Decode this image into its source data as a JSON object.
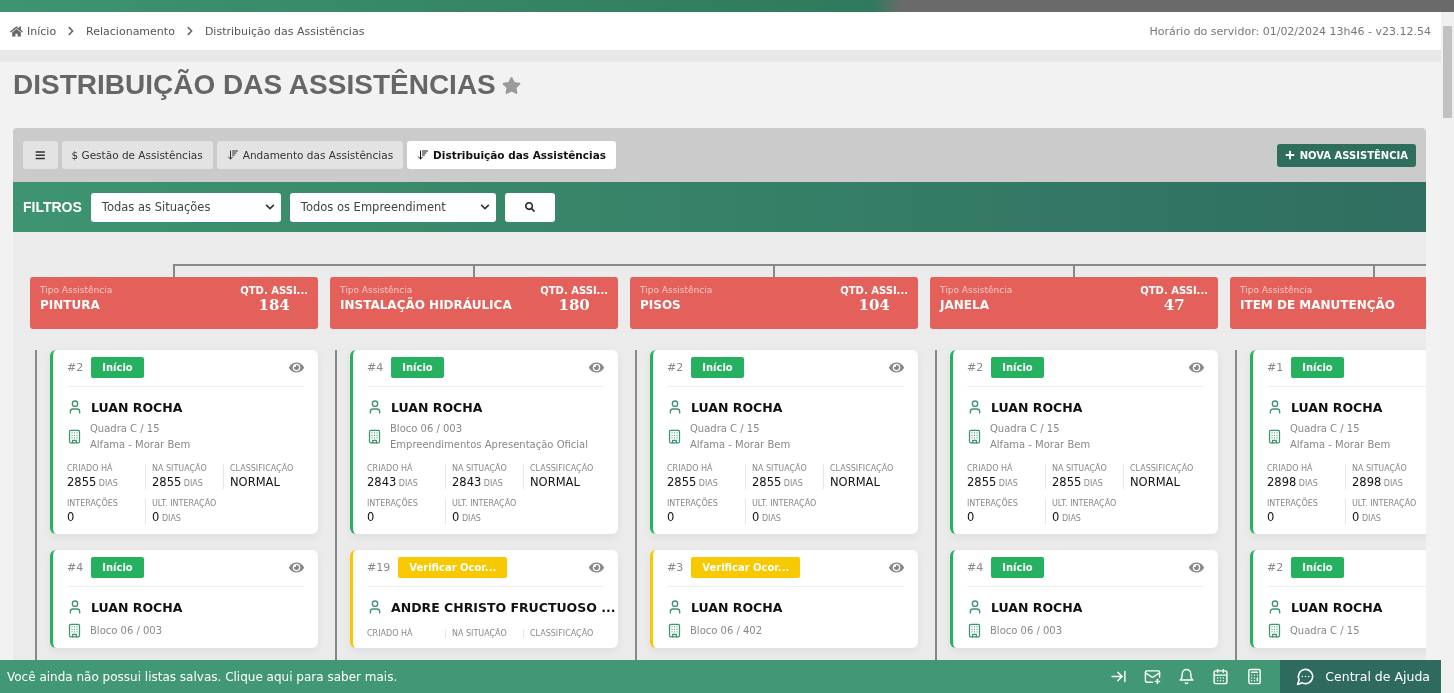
{
  "breadcrumb": [
    {
      "label": "Início"
    },
    {
      "label": "Relacionamento"
    },
    {
      "label": "Distribuição das Assistências"
    }
  ],
  "server_time": "Horário do servidor: 01/02/2024 13h46 - v23.12.54",
  "page_title": "DISTRIBUIÇÃO DAS ASSISTÊNCIAS",
  "tabs": [
    {
      "label": "$ Gestão de Assistências",
      "kind": "plain",
      "selected": false
    },
    {
      "label": "Andamento das Assistências",
      "kind": "sort",
      "selected": false
    },
    {
      "label": "Distribuição das Assistências",
      "kind": "sort",
      "selected": true
    }
  ],
  "new_button": "NOVA ASSISTÊNCIA",
  "filters": {
    "label": "FILTROS",
    "selects": [
      {
        "value": "Todas as Situações"
      },
      {
        "value": "Todos os Empreendiment"
      }
    ]
  },
  "columns": [
    {
      "type_label": "Tipo Assistência",
      "name": "PINTURA",
      "qty_label": "QTD. ASSI...",
      "qty": "184",
      "cards": [
        {
          "number": "#2",
          "status": {
            "label": "Início",
            "kind": "start"
          },
          "name": "LUAN ROCHA",
          "address": [
            "Quadra C / 15",
            "Alfama - Morar Bem"
          ],
          "stats": [
            [
              {
                "label": "CRIADO HÁ",
                "value": "2855",
                "unit": "DIAS"
              },
              {
                "label": "NA SITUAÇÃO",
                "value": "2855",
                "unit": "DIAS"
              },
              {
                "label": "CLASSIFICAÇÃO",
                "value": "NORMAL"
              }
            ],
            [
              {
                "label": "INTERAÇÕES",
                "value": "0"
              },
              {
                "label": "ULT. INTERAÇÃO",
                "value": "0",
                "unit": "DIAS"
              }
            ]
          ]
        },
        {
          "number": "#4",
          "status": {
            "label": "Início",
            "kind": "start"
          },
          "name": "LUAN ROCHA",
          "address": [
            "Bloco 06 / 003"
          ]
        }
      ]
    },
    {
      "type_label": "Tipo Assistência",
      "name": "INSTALAÇÃO HIDRÁULICA",
      "qty_label": "QTD. ASSI...",
      "qty": "180",
      "cards": [
        {
          "number": "#4",
          "status": {
            "label": "Início",
            "kind": "start"
          },
          "name": "LUAN ROCHA",
          "address": [
            "Bloco 06 / 003",
            "Empreendimentos Apresentação Oficial"
          ],
          "stats": [
            [
              {
                "label": "CRIADO HÁ",
                "value": "2843",
                "unit": "DIAS"
              },
              {
                "label": "NA SITUAÇÃO",
                "value": "2843",
                "unit": "DIAS"
              },
              {
                "label": "CLASSIFICAÇÃO",
                "value": "NORMAL"
              }
            ],
            [
              {
                "label": "INTERAÇÕES",
                "value": "0"
              },
              {
                "label": "ULT. INTERAÇÃO",
                "value": "0",
                "unit": "DIAS"
              }
            ]
          ]
        },
        {
          "number": "#19",
          "status": {
            "label": "Verificar Ocor...",
            "kind": "verify"
          },
          "name": "ANDRE CHRISTO FRUCTUOSO ...",
          "stats": [
            [
              {
                "label": "CRIADO HÁ"
              },
              {
                "label": "NA SITUAÇÃO"
              },
              {
                "label": "CLASSIFICAÇÃO"
              }
            ]
          ]
        }
      ]
    },
    {
      "type_label": "Tipo Assistência",
      "name": "PISOS",
      "qty_label": "QTD. ASSI...",
      "qty": "104",
      "cards": [
        {
          "number": "#2",
          "status": {
            "label": "Início",
            "kind": "start"
          },
          "name": "LUAN ROCHA",
          "address": [
            "Quadra C / 15",
            "Alfama - Morar Bem"
          ],
          "stats": [
            [
              {
                "label": "CRIADO HÁ",
                "value": "2855",
                "unit": "DIAS"
              },
              {
                "label": "NA SITUAÇÃO",
                "value": "2855",
                "unit": "DIAS"
              },
              {
                "label": "CLASSIFICAÇÃO",
                "value": "NORMAL"
              }
            ],
            [
              {
                "label": "INTERAÇÕES",
                "value": "0"
              },
              {
                "label": "ULT. INTERAÇÃO",
                "value": "0",
                "unit": "DIAS"
              }
            ]
          ]
        },
        {
          "number": "#3",
          "status": {
            "label": "Verificar Ocor...",
            "kind": "verify"
          },
          "name": "LUAN ROCHA",
          "address": [
            "Bloco 06 / 402"
          ]
        }
      ]
    },
    {
      "type_label": "Tipo Assistência",
      "name": "JANELA",
      "qty_label": "QTD. ASSI...",
      "qty": "47",
      "cards": [
        {
          "number": "#2",
          "status": {
            "label": "Início",
            "kind": "start"
          },
          "name": "LUAN ROCHA",
          "address": [
            "Quadra C / 15",
            "Alfama - Morar Bem"
          ],
          "stats": [
            [
              {
                "label": "CRIADO HÁ",
                "value": "2855",
                "unit": "DIAS"
              },
              {
                "label": "NA SITUAÇÃO",
                "value": "2855",
                "unit": "DIAS"
              },
              {
                "label": "CLASSIFICAÇÃO",
                "value": "NORMAL"
              }
            ],
            [
              {
                "label": "INTERAÇÕES",
                "value": "0"
              },
              {
                "label": "ULT. INTERAÇÃO",
                "value": "0",
                "unit": "DIAS"
              }
            ]
          ]
        },
        {
          "number": "#4",
          "status": {
            "label": "Início",
            "kind": "start"
          },
          "name": "LUAN ROCHA",
          "address": [
            "Bloco 06 / 003"
          ]
        }
      ]
    },
    {
      "type_label": "Tipo Assistência",
      "name": "ITEM DE MANUTENÇÃO",
      "cards": [
        {
          "number": "#1",
          "status": {
            "label": "Início",
            "kind": "start"
          },
          "name": "LUAN ROCHA",
          "address": [
            "Quadra C / 15",
            "Alfama - Morar Bem"
          ],
          "stats": [
            [
              {
                "label": "CRIADO HÁ",
                "value": "2898",
                "unit": "DIAS"
              },
              {
                "label": "NA SITUAÇÃO",
                "value": "2898",
                "unit": "DIAS"
              }
            ],
            [
              {
                "label": "INTERAÇÕES",
                "value": "0"
              },
              {
                "label": "ULT. INTERAÇÃO",
                "value": "0",
                "unit": "DIAS"
              }
            ]
          ]
        },
        {
          "number": "#2",
          "status": {
            "label": "Início",
            "kind": "start"
          },
          "name": "LUAN ROCHA",
          "address": [
            "Quadra C / 15"
          ]
        }
      ]
    }
  ],
  "footer": {
    "message": "Você ainda não possui listas salvas. Clique aqui para saber mais.",
    "help": "Central de Ajuda"
  }
}
